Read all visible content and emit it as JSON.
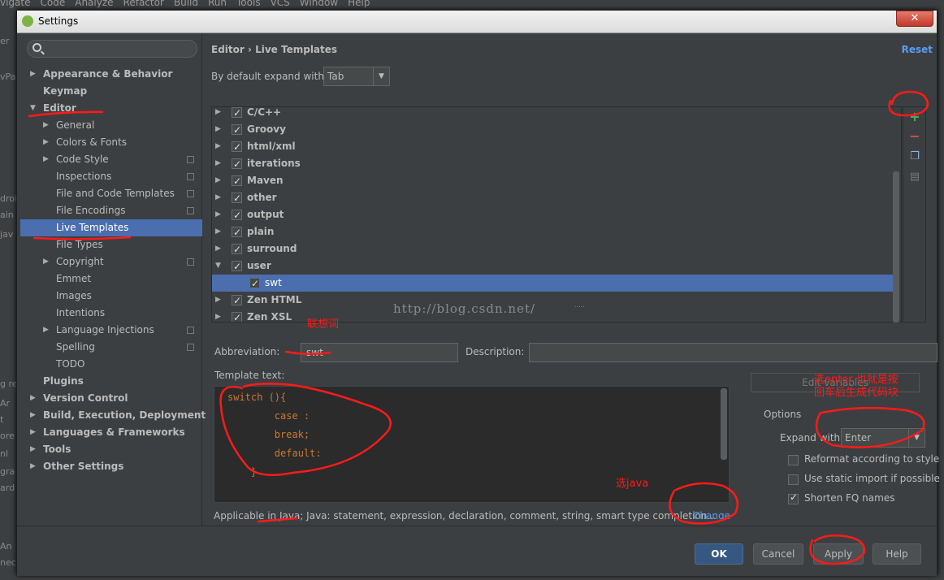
{
  "ide_menu": [
    "vigate",
    "Code",
    "Analyze",
    "Refactor",
    "Build",
    "Run",
    "Tools",
    "VCS",
    "Window",
    "Help"
  ],
  "ide_left_fragments": [
    "er",
    "vPa",
    "droi",
    "ain",
    "jav",
    "g re",
    "Ar",
    "t",
    "ore",
    "nl",
    "gra",
    "ard",
    "An",
    "nec"
  ],
  "dialog": {
    "title": "Settings",
    "close": "✕"
  },
  "sidebar": {
    "items": [
      {
        "label": "Appearance & Behavior",
        "level": 0,
        "bold": true,
        "arrow": "▶"
      },
      {
        "label": "Keymap",
        "level": 0,
        "bold": true,
        "arrow": ""
      },
      {
        "label": "Editor",
        "level": 0,
        "bold": true,
        "arrow": "▼"
      },
      {
        "label": "General",
        "level": 1,
        "arrow": "▶"
      },
      {
        "label": "Colors & Fonts",
        "level": 1,
        "arrow": "▶"
      },
      {
        "label": "Code Style",
        "level": 1,
        "arrow": "▶",
        "copy": true
      },
      {
        "label": "Inspections",
        "level": 1,
        "copy": true
      },
      {
        "label": "File and Code Templates",
        "level": 1,
        "copy": true
      },
      {
        "label": "File Encodings",
        "level": 1,
        "copy": true
      },
      {
        "label": "Live Templates",
        "level": 1,
        "selected": true
      },
      {
        "label": "File Types",
        "level": 1
      },
      {
        "label": "Copyright",
        "level": 1,
        "arrow": "▶",
        "copy": true
      },
      {
        "label": "Emmet",
        "level": 1
      },
      {
        "label": "Images",
        "level": 1
      },
      {
        "label": "Intentions",
        "level": 1
      },
      {
        "label": "Language Injections",
        "level": 1,
        "arrow": "▶",
        "copy": true
      },
      {
        "label": "Spelling",
        "level": 1,
        "copy": true
      },
      {
        "label": "TODO",
        "level": 1
      },
      {
        "label": "Plugins",
        "level": 0,
        "bold": true
      },
      {
        "label": "Version Control",
        "level": 0,
        "bold": true,
        "arrow": "▶"
      },
      {
        "label": "Build, Execution, Deployment",
        "level": 0,
        "bold": true,
        "arrow": "▶"
      },
      {
        "label": "Languages & Frameworks",
        "level": 0,
        "bold": true,
        "arrow": "▶"
      },
      {
        "label": "Tools",
        "level": 0,
        "bold": true,
        "arrow": "▶"
      },
      {
        "label": "Other Settings",
        "level": 0,
        "bold": true,
        "arrow": "▶"
      }
    ]
  },
  "main": {
    "breadcrumb": "Editor › Live Templates",
    "reset": "Reset",
    "expand_label": "By default expand with",
    "expand_value": "Tab",
    "groups": [
      {
        "label": "C/C++",
        "arrow": "▶"
      },
      {
        "label": "Groovy",
        "arrow": "▶"
      },
      {
        "label": "html/xml",
        "arrow": "▶"
      },
      {
        "label": "iterations",
        "arrow": "▶"
      },
      {
        "label": "Maven",
        "arrow": "▶"
      },
      {
        "label": "other",
        "arrow": "▶"
      },
      {
        "label": "output",
        "arrow": "▶"
      },
      {
        "label": "plain",
        "arrow": "▶"
      },
      {
        "label": "surround",
        "arrow": "▶"
      },
      {
        "label": "user",
        "arrow": "▼"
      },
      {
        "label": "swt",
        "arrow": "",
        "child": true,
        "selected": true
      },
      {
        "label": "Zen HTML",
        "arrow": "▶"
      },
      {
        "label": "Zen XSL",
        "arrow": "▶"
      }
    ],
    "watermark": "http://blog.csdn.net/",
    "abbreviation_label": "Abbreviation:",
    "abbreviation_value": "swt",
    "description_label": "Description:",
    "description_value": "",
    "template_label": "Template text:",
    "template_lines": [
      "switch (){",
      "        case :",
      "        break;",
      "        default:",
      "    }"
    ],
    "edit_variables": "Edit variables",
    "options_label": "Options",
    "expand_with_label": "Expand with",
    "expand_with_value": "Enter",
    "opt_reformat": "Reformat according to style",
    "opt_static": "Use static import if possible",
    "opt_shorten": "Shorten FQ names",
    "applicable": "Applicable in Java; Java: statement, expression, declaration, comment, string, smart type completion...",
    "change": "Change"
  },
  "footer": {
    "ok": "OK",
    "cancel": "Cancel",
    "apply": "Apply",
    "help": "Help"
  },
  "annotations": {
    "abbr": "联想词",
    "enter": "选enter 也就是按\n回车后生成代码块",
    "java": "选java"
  },
  "colors": {
    "accent": "#4b6eaf",
    "link": "#589df6",
    "annotation": "#ff1a1a",
    "add": "#4caf50",
    "remove": "#c75450"
  }
}
